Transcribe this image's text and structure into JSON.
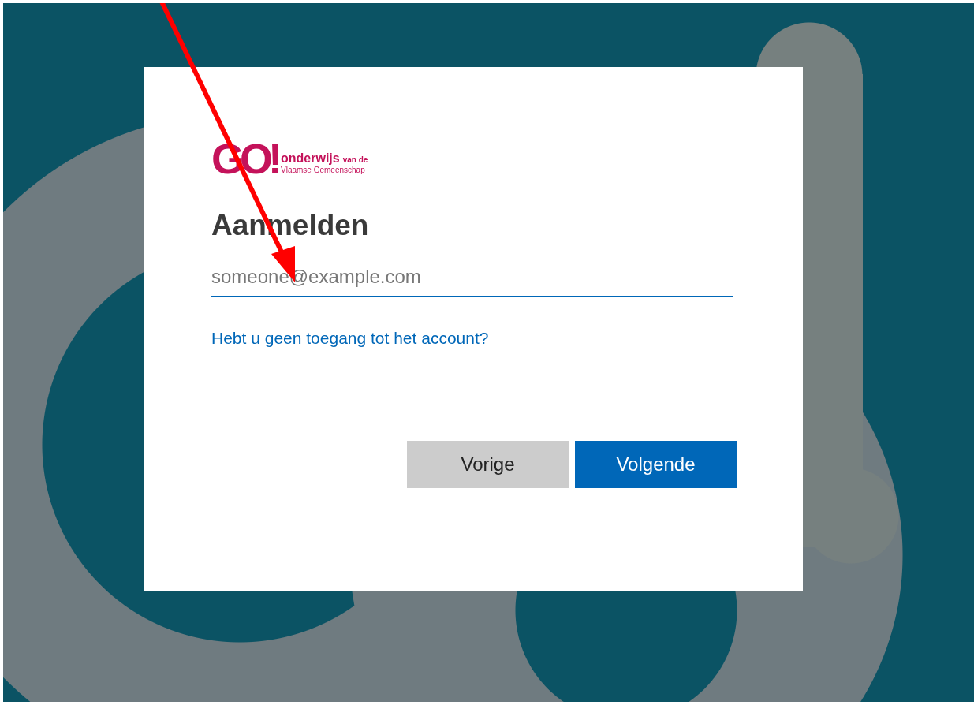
{
  "logo": {
    "mark": "GO!",
    "line1": "onderwijs",
    "line1_small": "van de",
    "line2": "Vlaamse Gemeenschap"
  },
  "heading": "Aanmelden",
  "email_field": {
    "placeholder": "someone@example.com"
  },
  "help_link": "Hebt u geen toegang tot het account?",
  "buttons": [
    {
      "label": "Vorige",
      "kind": "secondary"
    },
    {
      "label": "Volgende",
      "kind": "primary"
    }
  ]
}
